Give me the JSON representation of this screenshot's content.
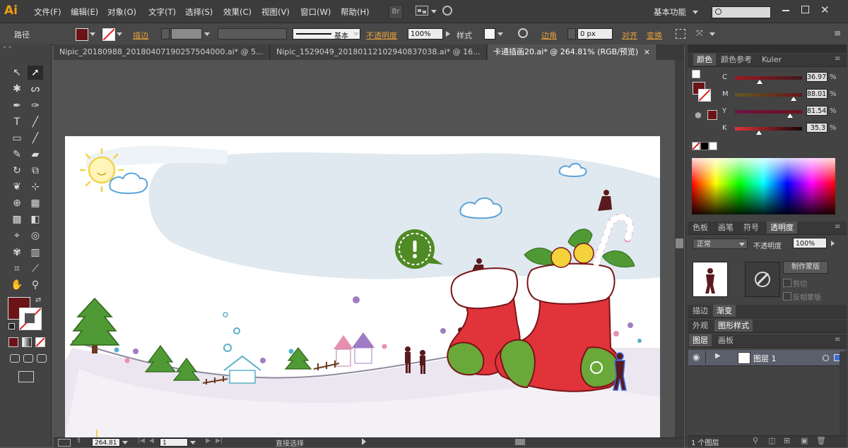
{
  "app": {
    "logo": "Ai",
    "workspace": "基本功能"
  },
  "menu": [
    "文件(F)",
    "编辑(E)",
    "对象(O)",
    "文字(T)",
    "选择(S)",
    "效果(C)",
    "视图(V)",
    "窗口(W)",
    "帮助(H)"
  ],
  "toolbar_buttons": {
    "bridge": "Br"
  },
  "control": {
    "object_type": "路径",
    "stroke_label": "描边",
    "stroke_style": "基本",
    "opacity_label": "不透明度",
    "opacity_value": "100%",
    "style_label": "样式",
    "corner_label": "边角",
    "corner_value": "0 px",
    "align_label": "对齐",
    "transform_label": "变换"
  },
  "tabs": [
    {
      "label": "Nipic_20180988_20180407190257504000.ai* @ 5...",
      "close": "×"
    },
    {
      "label": "Nipic_1529049_20180112102940837038.ai* @ 16...",
      "close": "×"
    },
    {
      "label": "卡通插画20.ai* @ 264.81% (RGB/预览)",
      "close": "×"
    }
  ],
  "color_panel": {
    "tabs": [
      "颜色",
      "颜色参考",
      "Kuler"
    ],
    "channels": [
      {
        "name": "C",
        "value": "36.97"
      },
      {
        "name": "M",
        "value": "88.01"
      },
      {
        "name": "Y",
        "value": "81.54"
      },
      {
        "name": "K",
        "value": "35.3"
      }
    ],
    "fill_color": "#6b1418"
  },
  "transparency_panel": {
    "tabs": [
      "色板",
      "画笔",
      "符号",
      "透明度"
    ],
    "blend_mode": "正常",
    "opacity_label": "不透明度",
    "opacity_value": "100%",
    "make_mask": "制作蒙版",
    "clip": "剪切",
    "invert_mask": "反相蒙版"
  },
  "stroke_panel": {
    "tabs": [
      "描边",
      "渐变"
    ]
  },
  "appearance_panel": {
    "tabs": [
      "外观",
      "图形样式"
    ]
  },
  "layers_panel": {
    "tabs": [
      "图层",
      "画板"
    ],
    "layer_name": "图层 1",
    "count": "1 个图层"
  },
  "status": {
    "zoom": "264.81",
    "page": "1",
    "tool": "直接选择"
  },
  "colors": {
    "accent_orange": "#e7a03b",
    "stocking_red": "#e0343a",
    "leaf_green": "#6aa83a",
    "dark_brown": "#5a1a1e"
  }
}
